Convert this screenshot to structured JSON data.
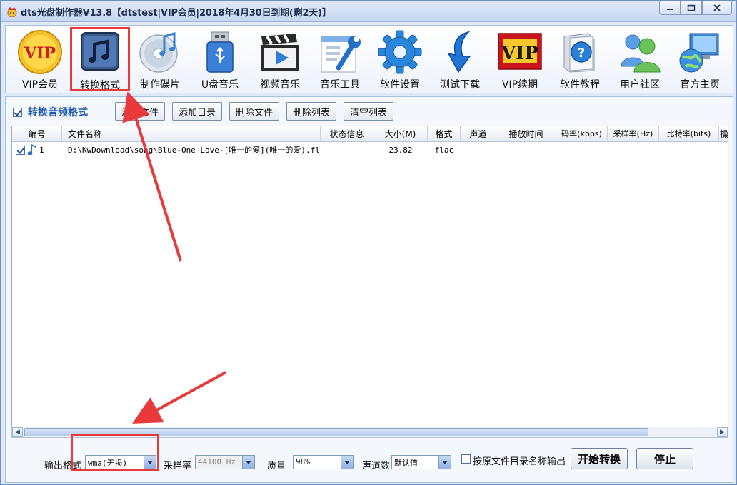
{
  "window": {
    "title": "dts光盘制作器V13.8【dtstest|VIP会员|2018年4月30日到期(剩2天)】"
  },
  "toolbar": {
    "items": [
      {
        "label": "VIP会员",
        "icon": "vip-badge-icon"
      },
      {
        "label": "转换格式",
        "icon": "music-note-icon"
      },
      {
        "label": "制作碟片",
        "icon": "disc-icon"
      },
      {
        "label": "U盘音乐",
        "icon": "usb-drive-icon"
      },
      {
        "label": "视频音乐",
        "icon": "clapperboard-icon"
      },
      {
        "label": "音乐工具",
        "icon": "wrench-icon"
      },
      {
        "label": "软件设置",
        "icon": "gear-icon"
      },
      {
        "label": "测试下载",
        "icon": "download-arrow-icon"
      },
      {
        "label": "VIP续期",
        "icon": "vip-renew-icon"
      },
      {
        "label": "软件教程",
        "icon": "help-book-icon"
      },
      {
        "label": "用户社区",
        "icon": "users-icon"
      },
      {
        "label": "官方主页",
        "icon": "globe-computer-icon"
      }
    ],
    "vip_text": "VIP"
  },
  "panel": {
    "mode_label": "转换音频格式",
    "buttons": [
      "添加文件",
      "添加目录",
      "删除文件",
      "删除列表",
      "清空列表"
    ]
  },
  "table": {
    "columns": [
      "编号",
      "文件名称",
      "状态信息",
      "大小(M)",
      "格式",
      "声道",
      "播放时间",
      "码率(kbps)",
      "采样率(Hz)",
      "比特率(bits)",
      "操"
    ],
    "rows": [
      {
        "index": "1",
        "filename": "D:\\KwDownload\\song\\Blue-One Love-[唯一的爱](唯一的爱).flac",
        "status": "",
        "size": "23.82",
        "format": "flac",
        "channels": "",
        "duration": "",
        "bitrate": "",
        "samplerate": "",
        "bits": ""
      }
    ]
  },
  "bottom": {
    "output_format_label": "输出格式",
    "output_format_value": "wma(无损)",
    "samplerate_label": "采样率",
    "samplerate_value": "44100 Hz",
    "quality_label": "质量",
    "quality_value": "98%",
    "channels_label": "声道数",
    "channels_value": "默认值",
    "keep_dir_label": "按原文件目录名称输出",
    "start_button": "开始转换",
    "stop_button": "停止"
  },
  "colors": {
    "highlight_red": "#e8393b",
    "accent_blue": "#1e5bb5"
  }
}
